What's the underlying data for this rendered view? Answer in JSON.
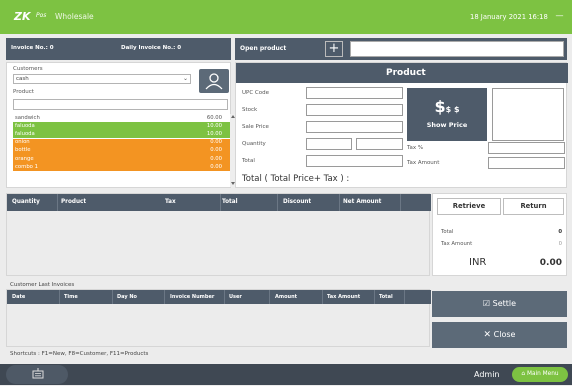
{
  "titlebar": {
    "logo": "ZK",
    "logo_sub": "Pos",
    "app_title": "Wholesale",
    "datetime": "18 January 2021 16:18",
    "minimize_glyph": "—",
    "bg": "#7dc242"
  },
  "invoice_bar": {
    "invoice_no": "Invoice No.: 0",
    "daily_invoice_no": "Daily Invoice No.: 0"
  },
  "open_product": {
    "label": "Open product",
    "add_glyph": "+"
  },
  "customers": {
    "label": "Customers",
    "selected": "cash",
    "add_customer_icon": "person-icon"
  },
  "product_search": {
    "label": "Product",
    "value": ""
  },
  "product_list": [
    {
      "name": "sandwich",
      "price": "60.00",
      "color": "#ffffff"
    },
    {
      "name": "faluoda",
      "price": "10.00",
      "color": "#7dc242"
    },
    {
      "name": "faluoda",
      "price": "10.00",
      "color": "#7dc242"
    },
    {
      "name": "onion",
      "price": "0.00",
      "color": "#f39422"
    },
    {
      "name": "bottle",
      "price": "0.00",
      "color": "#f39422"
    },
    {
      "name": "orange",
      "price": "0.00",
      "color": "#f39422"
    },
    {
      "name": "combo 1",
      "price": "0.00",
      "color": "#f39422"
    }
  ],
  "product_panel": {
    "title": "Product",
    "labels": {
      "upc": "UPC Code",
      "stock": "Stock",
      "sale_price": "Sale Price",
      "quantity": "Quantity",
      "total": "Total",
      "tax_pct": "Tax %",
      "tax_amount": "Tax Amount"
    },
    "show_price": {
      "symbol": "$",
      "small": "$ $",
      "label": "Show Price"
    },
    "total_plus_tax": "Total ( Total Price+ Tax ) :"
  },
  "grid": {
    "columns": [
      "Quantity",
      "Product",
      "Tax",
      "Total",
      "Discount",
      "Net Amount"
    ]
  },
  "actions": {
    "retrieve": "Retrieve",
    "return": "Return"
  },
  "totals": {
    "total_label": "Total",
    "total_value": "0",
    "tax_label": "Tax Amount",
    "tax_value": "0",
    "currency": "INR",
    "grand_total": "0.00"
  },
  "customer_last_invoices": {
    "title": "Customer Last Invoices",
    "columns": [
      "Date",
      "Time",
      "Day No",
      "Invoice Number",
      "User",
      "Amount",
      "Tax Amount",
      "Total"
    ]
  },
  "buttons": {
    "settle": "Settle",
    "close": "Close",
    "settle_icon": "check-box-icon",
    "close_icon": "x-icon"
  },
  "shortcuts": "Shortcuts : F1=New, F8=Customer, F11=Products",
  "bottombar": {
    "keyboard_icon": "keyboard-icon",
    "user": "Admin",
    "main_menu": "Main Menu",
    "main_menu_icon": "home-icon"
  }
}
